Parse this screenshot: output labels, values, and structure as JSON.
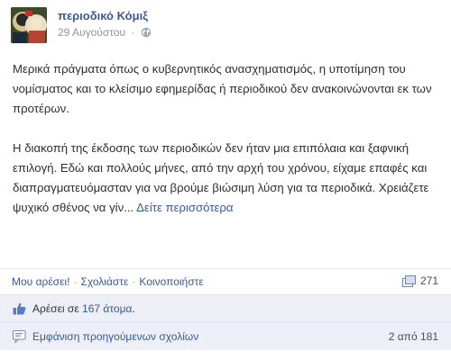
{
  "header": {
    "page_name": "περιοδικό Κόμιξ",
    "date": "29 Αυγούστου",
    "separator": "·",
    "privacy_icon": "globe-icon"
  },
  "post": {
    "paragraph_1": "Μερικά πράγματα όπως ο κυβερνητικός ανασχηματισμός, η υποτίμηση του νομίσματος και το κλείσιμο εφημερίδας ή περιοδικού δεν ανακοινώνονται εκ των προτέρων.",
    "paragraph_2": "Η διακοπή της έκδοσης των περιοδικών δεν ήταν μια επιπόλαια και ξαφνική επιλογή. Εδώ και πολλούς μήνες, από την αρχή του χρόνου, είχαμε επαφές και διαπραγματευόμασταν για να βρούμε βιώσιμη λύση για τα περιοδικά. Χρειάζετε ψυχικό σθένος να γίν...",
    "see_more": "Δείτε περισσότερα"
  },
  "actions": {
    "like": "Μου αρέσει!",
    "comment": "Σχολιάστε",
    "share": "Κοινοποιήστε",
    "separator": "·",
    "share_count": "271",
    "share_icon": "share-icon"
  },
  "likes": {
    "prefix": "Αρέσει σε",
    "count_link": "167 άτομα",
    "suffix": ".",
    "icon": "thumbs-up-icon"
  },
  "comments": {
    "label": "Εμφάνιση προηγούμενων σχολίων",
    "counter": "2 από 181",
    "icon": "comment-icon"
  },
  "colors": {
    "link": "#3b5998",
    "feedback_bg": "#eceff5",
    "meta": "#90949c"
  }
}
